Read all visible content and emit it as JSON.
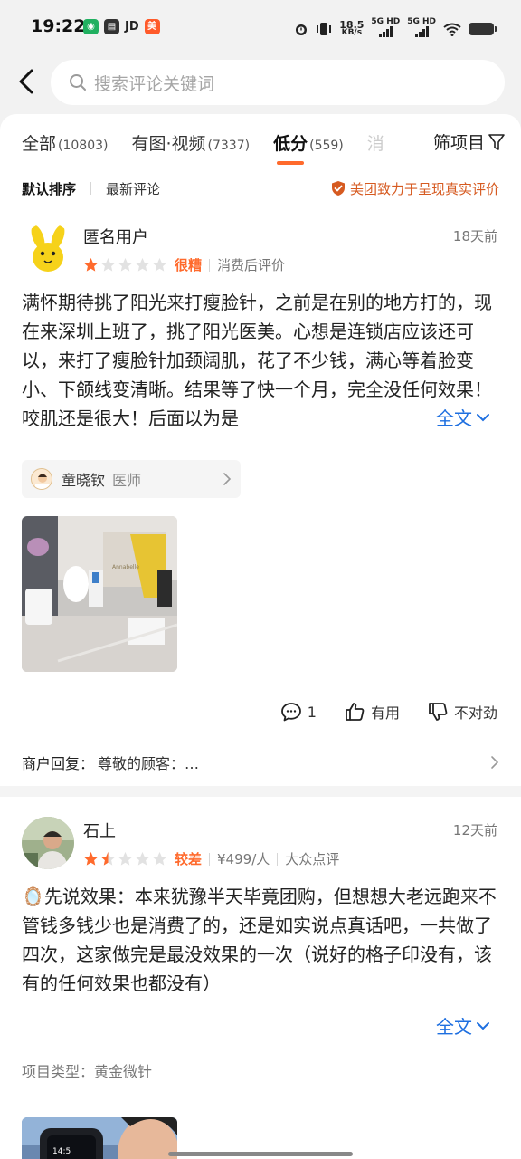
{
  "status_bar": {
    "time": "19:22",
    "jd_label": "JD",
    "net_speed": "18.5",
    "net_unit": "KB/s",
    "sig1": "5G HD",
    "sig2": "5G HD"
  },
  "search": {
    "placeholder": "搜索评论关键词"
  },
  "tabs": [
    {
      "label": "全部",
      "count": "(10803)"
    },
    {
      "label": "有图·视频",
      "count": "(7337)"
    },
    {
      "label": "低分",
      "count": "(559)"
    },
    {
      "label": "消"
    }
  ],
  "filter_label": "筛项目",
  "sort": {
    "default": "默认排序",
    "latest": "最新评论",
    "trust_text": "美团致力于呈现真实评价"
  },
  "reviews": [
    {
      "user": "匿名用户",
      "time": "18天前",
      "rating": 1,
      "rating_word": "很糟",
      "meta": "消费后评价",
      "text": "满怀期待挑了阳光来打瘦脸针，之前是在别的地方打的，现在来深圳上班了，挑了阳光医美。心想是连锁店应该还可以，来打了瘦脸针加颈阔肌，花了不少钱，满心等着脸变小、下颌线变清晰。结果等了快一个月，完全没任何效果！咬肌还是很大！后面以为是",
      "full_label": "全文",
      "doctor_name": "童晓钦",
      "doctor_role": "医师",
      "comment_count": "1",
      "useful": "有用",
      "unhelpful": "不对劲",
      "reply_label": "商户回复：",
      "reply_text": "尊敬的顾客：…"
    },
    {
      "user": "石上",
      "time": "12天前",
      "rating": 1.5,
      "rating_word": "较差",
      "price": "¥499/人",
      "meta": "大众点评",
      "text_emoji": "🪞",
      "text": "先说效果：本来犹豫半天毕竟团购，但想想大老远跑来不管钱多钱少也是消费了的，还是如实说点真话吧，一共做了四次，这家做完是最没效果的一次（说好的格子印没有，该有的任何效果也都没有）",
      "full_label": "全文",
      "project_label": "项目类型：",
      "project_value": "黄金微针"
    }
  ],
  "colors": {
    "accent": "#ff6a2c",
    "link": "#1e6fe0",
    "trust": "#d65a20",
    "star_off": "#e2e2e2"
  }
}
